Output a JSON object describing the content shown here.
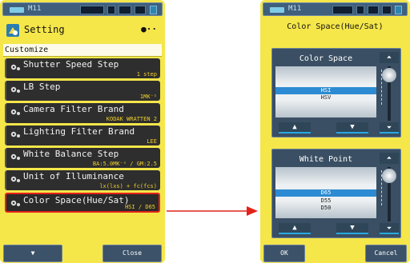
{
  "left": {
    "status": {
      "mode": "M11"
    },
    "header": {
      "title": "Setting",
      "page_indicator": "●··"
    },
    "section_label": "Customize",
    "menu": [
      {
        "label": "Shutter Speed Step",
        "value": "1 step"
      },
      {
        "label": "LB Step",
        "value": "1MK⁻¹"
      },
      {
        "label": "Camera Filter Brand",
        "value": "KODAK WRATTEN 2"
      },
      {
        "label": "Lighting Filter Brand",
        "value": "LEE"
      },
      {
        "label": "White Balance Step",
        "value": "BA:5.0MK⁻¹ / GM:2.5"
      },
      {
        "label": "Unit of Illuminance",
        "value": "lx(lxs) + fc(fcs)"
      },
      {
        "label": "Color Space(Hue/Sat)",
        "value": "HSI / D65"
      }
    ],
    "bottom": {
      "down": "▼",
      "close": "Close"
    }
  },
  "right": {
    "status": {
      "mode": "M11"
    },
    "title": "Color Space(Hue/Sat)",
    "color_space": {
      "header": "Color Space",
      "options": [
        "HSI",
        "HSV"
      ],
      "selected": "HSI",
      "up": "▲",
      "down": "▼",
      "top": "⏶",
      "bottom": "⏷"
    },
    "white_point": {
      "header": "White Point",
      "options": [
        "D65",
        "D55",
        "D50"
      ],
      "selected": "D65",
      "up": "▲",
      "down": "▼",
      "top": "⏶",
      "bottom": "⏷"
    },
    "bottom": {
      "ok": "OK",
      "cancel": "Cancel"
    }
  },
  "colors": {
    "device": "#f5e64a",
    "accent": "#27a9e1",
    "selection": "#e2231a",
    "value": "#f0cf2a"
  }
}
